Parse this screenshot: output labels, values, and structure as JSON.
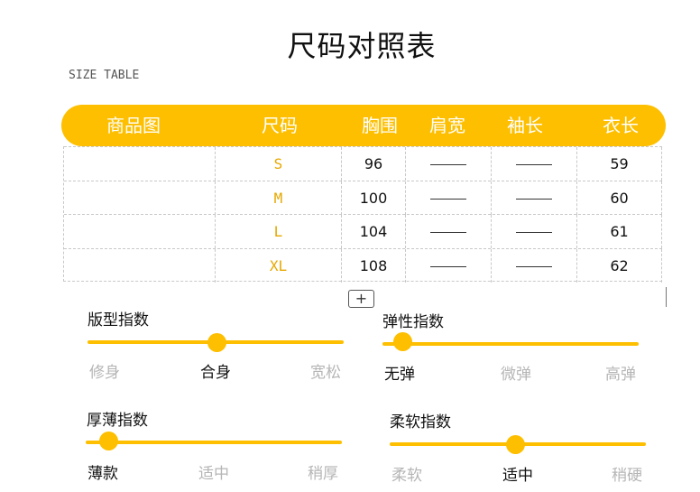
{
  "title": "尺码对照表",
  "subtitle": "SIZE TABLE",
  "table": {
    "headers": [
      "商品图",
      "尺码",
      "胸围",
      "肩宽",
      "袖长",
      "衣长"
    ],
    "rows": [
      {
        "size": "S",
        "chest": "96",
        "length": "59"
      },
      {
        "size": "M",
        "chest": "100",
        "length": "60"
      },
      {
        "size": "L",
        "chest": "104",
        "length": "61"
      },
      {
        "size": "XL",
        "chest": "108",
        "length": "62"
      }
    ]
  },
  "expand_button": "+",
  "indices": {
    "fit": {
      "label": "版型指数",
      "options": [
        "修身",
        "合身",
        "宽松"
      ],
      "selected": 1
    },
    "elastic": {
      "label": "弹性指数",
      "options": [
        "无弹",
        "微弹",
        "高弹"
      ],
      "selected": 0
    },
    "thickness": {
      "label": "厚薄指数",
      "options": [
        "薄款",
        "适中",
        "稍厚"
      ],
      "selected": 0
    },
    "softness": {
      "label": "柔软指数",
      "options": [
        "柔软",
        "适中",
        "稍硬"
      ],
      "selected": 1
    }
  },
  "colors": {
    "accent": "#fdbf00",
    "size_text": "#e6a800",
    "inactive_text": "#b5b5b5"
  }
}
